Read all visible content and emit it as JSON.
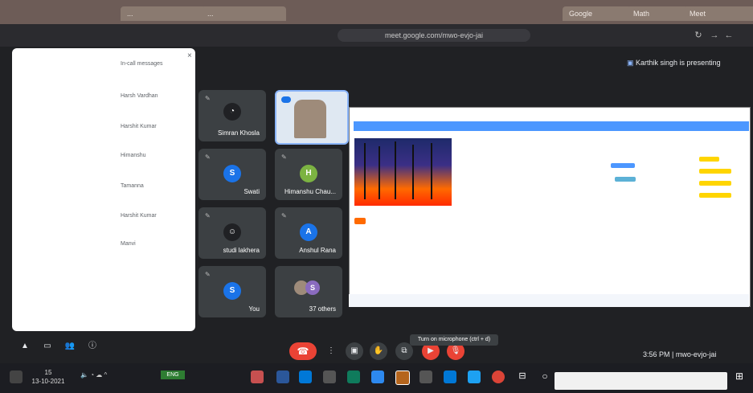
{
  "browser": {
    "tabs": [
      "...",
      "...",
      "Math",
      "Google",
      "Meet"
    ],
    "url": "meet.google.com/mwo-evjo-jai"
  },
  "meet": {
    "presenter_banner": "Karthik singh is presenting",
    "tiles": [
      {
        "name": "Simran Khosla",
        "initial": "S",
        "color": "#5f6368"
      },
      {
        "name": "Himanshu Chau...",
        "initial": "H",
        "color": "#7cb342"
      },
      {
        "name": "Swati",
        "initial": "S",
        "color": "#1a73e8"
      },
      {
        "name": "Anshul Rana",
        "initial": "A",
        "color": "#1a73e8"
      },
      {
        "name": "studi lakhera",
        "initial": "",
        "color": "#202124"
      },
      {
        "name": "37 others",
        "initial": "",
        "color": "#3c4043"
      },
      {
        "name": "You",
        "initial": "S",
        "color": "#1a73e8"
      }
    ],
    "side_panel_rows": [
      "In-call messages",
      "Harsh Vardhan",
      "Harshit Kumar",
      "Himanshu",
      "Tamanna",
      "Harshit Kumar",
      "Manvi"
    ],
    "tooltip": "Turn on microphone (ctrl + d)",
    "meeting_code": "3:56 PM | mwo-evjo-jai"
  },
  "taskbar": {
    "clock_time": "15",
    "clock_date": "13-10-2021",
    "battery": "ENG"
  },
  "colors": {
    "meet_bg": "#202124",
    "tile_bg": "#3c4043",
    "end_call": "#ea4335",
    "mic_off": "#ea4335",
    "scratch_blue": "#4c97ff"
  }
}
